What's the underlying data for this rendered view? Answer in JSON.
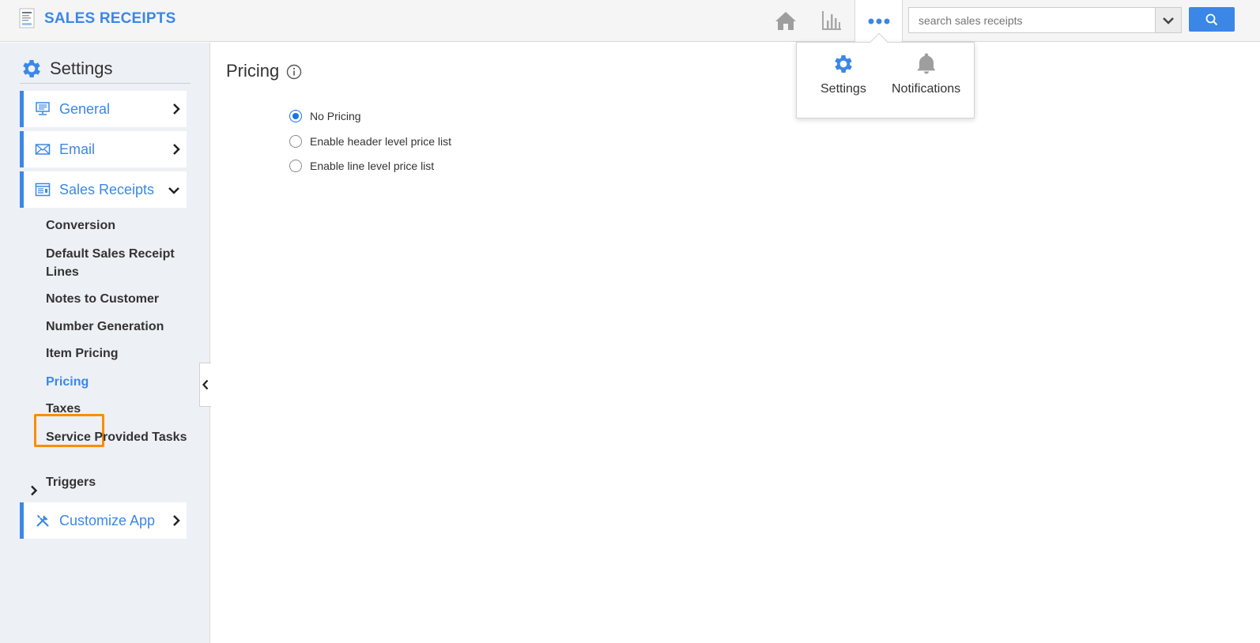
{
  "app": {
    "title": "SALES RECEIPTS"
  },
  "search": {
    "placeholder": "search sales receipts"
  },
  "popover": {
    "items": [
      {
        "label": "Settings",
        "icon": "gear-icon"
      },
      {
        "label": "Notifications",
        "icon": "bell-icon"
      }
    ]
  },
  "sidebar": {
    "title": "Settings",
    "cards": [
      {
        "label": "General",
        "icon": "monitor-icon",
        "expanded": false
      },
      {
        "label": "Email",
        "icon": "envelope-icon",
        "expanded": false
      },
      {
        "label": "Sales Receipts",
        "icon": "receipt-icon",
        "expanded": true
      },
      {
        "label": "Customize App",
        "icon": "tools-icon",
        "expanded": false
      }
    ],
    "sub_items": [
      "Conversion",
      "Default Sales Receipt Lines",
      "Notes to Customer",
      "Number Generation",
      "Item Pricing",
      "Pricing",
      "Taxes",
      "Service Provided Tasks",
      "Triggers"
    ],
    "active_item": "Pricing"
  },
  "main": {
    "title": "Pricing",
    "options": [
      {
        "label": "No Pricing",
        "checked": true
      },
      {
        "label": "Enable header level price list",
        "checked": false
      },
      {
        "label": "Enable line level price list",
        "checked": false
      }
    ]
  },
  "colors": {
    "accent": "#3b87e8",
    "highlight": "#fb8c00",
    "sidebar_bg": "#edf0f5"
  }
}
